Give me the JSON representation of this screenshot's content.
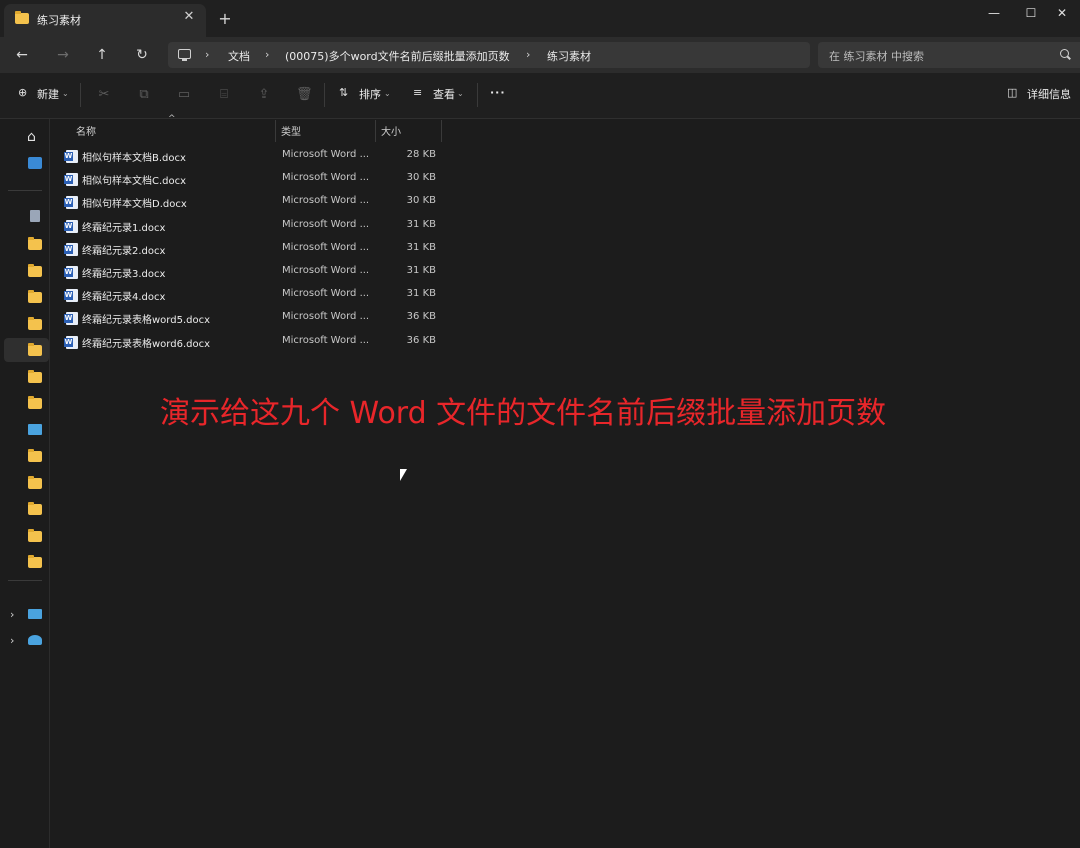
{
  "window": {
    "tab_title": "练习素材",
    "close_tab": "✕",
    "new_tab": "+",
    "minimize": "—",
    "maximize": "☐",
    "close": "✕"
  },
  "nav": {
    "back": "←",
    "forward": "→",
    "up": "↑",
    "refresh": "↻",
    "breadcrumbs": [
      "文档",
      "(00075)多个word文件名前后缀批量添加页数",
      "练习素材"
    ],
    "separator": "›",
    "search_placeholder": "在 练习素材 中搜索"
  },
  "toolbar": {
    "new_label": "新建",
    "sort_label": "排序",
    "view_label": "查看",
    "more_label": "···",
    "details_label": "详细信息"
  },
  "columns": {
    "name": "名称",
    "type": "类型",
    "size": "大小"
  },
  "files": [
    {
      "name": "相似句样本文档B.docx",
      "type": "Microsoft Word ...",
      "size": "28 KB"
    },
    {
      "name": "相似句样本文档C.docx",
      "type": "Microsoft Word ...",
      "size": "30 KB"
    },
    {
      "name": "相似句样本文档D.docx",
      "type": "Microsoft Word ...",
      "size": "30 KB"
    },
    {
      "name": "终霜纪元录1.docx",
      "type": "Microsoft Word ...",
      "size": "31 KB"
    },
    {
      "name": "终霜纪元录2.docx",
      "type": "Microsoft Word ...",
      "size": "31 KB"
    },
    {
      "name": "终霜纪元录3.docx",
      "type": "Microsoft Word ...",
      "size": "31 KB"
    },
    {
      "name": "终霜纪元录4.docx",
      "type": "Microsoft Word ...",
      "size": "31 KB"
    },
    {
      "name": "终霜纪元录表格word5.docx",
      "type": "Microsoft Word ...",
      "size": "36 KB"
    },
    {
      "name": "终霜纪元录表格word6.docx",
      "type": "Microsoft Word ...",
      "size": "36 KB"
    }
  ],
  "overlay_caption": "演示给这九个 Word 文件的文件名前后缀批量添加页数",
  "colors": {
    "accent_folder": "#f4c24d",
    "caption_red": "#e8262a",
    "background": "#1c1c1c"
  }
}
